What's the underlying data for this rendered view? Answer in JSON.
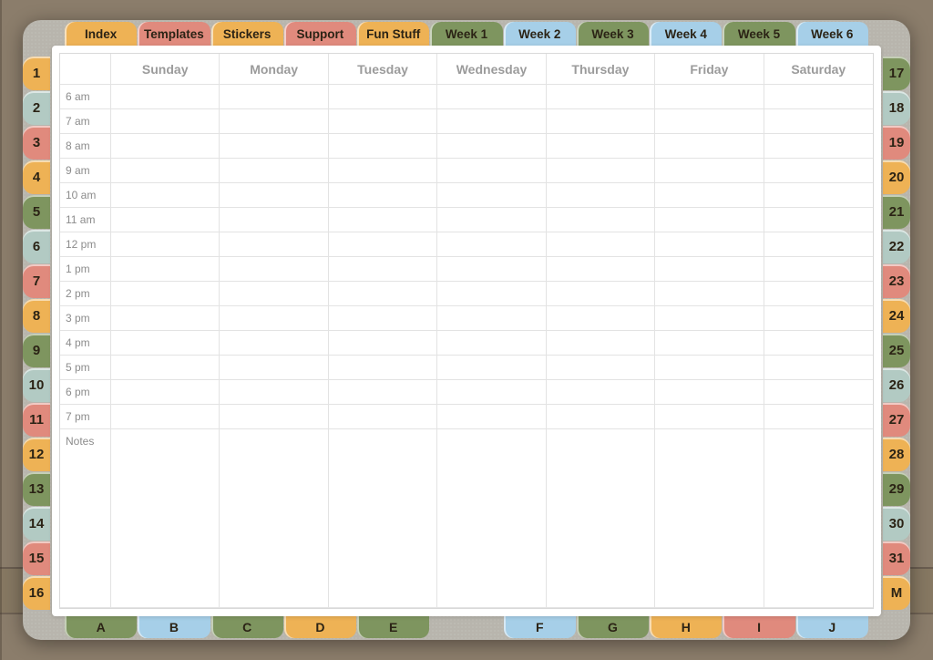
{
  "topTabs": [
    {
      "label": "Index",
      "color": "c-orange"
    },
    {
      "label": "Templates",
      "color": "c-red"
    },
    {
      "label": "Stickers",
      "color": "c-orange"
    },
    {
      "label": "Support",
      "color": "c-red"
    },
    {
      "label": "Fun Stuff",
      "color": "c-orange"
    },
    {
      "label": "Week 1",
      "color": "c-green"
    },
    {
      "label": "Week 2",
      "color": "c-blue"
    },
    {
      "label": "Week 3",
      "color": "c-green"
    },
    {
      "label": "Week 4",
      "color": "c-blue"
    },
    {
      "label": "Week 5",
      "color": "c-green"
    },
    {
      "label": "Week 6",
      "color": "c-blue"
    }
  ],
  "leftTabs": [
    {
      "label": "1",
      "color": "c-orange"
    },
    {
      "label": "2",
      "color": "c-teal"
    },
    {
      "label": "3",
      "color": "c-red"
    },
    {
      "label": "4",
      "color": "c-orange"
    },
    {
      "label": "5",
      "color": "c-green"
    },
    {
      "label": "6",
      "color": "c-teal"
    },
    {
      "label": "7",
      "color": "c-red"
    },
    {
      "label": "8",
      "color": "c-orange"
    },
    {
      "label": "9",
      "color": "c-green"
    },
    {
      "label": "10",
      "color": "c-teal"
    },
    {
      "label": "11",
      "color": "c-red"
    },
    {
      "label": "12",
      "color": "c-orange"
    },
    {
      "label": "13",
      "color": "c-green"
    },
    {
      "label": "14",
      "color": "c-teal"
    },
    {
      "label": "15",
      "color": "c-red"
    },
    {
      "label": "16",
      "color": "c-orange"
    }
  ],
  "rightTabs": [
    {
      "label": "17",
      "color": "c-green"
    },
    {
      "label": "18",
      "color": "c-teal"
    },
    {
      "label": "19",
      "color": "c-red"
    },
    {
      "label": "20",
      "color": "c-orange"
    },
    {
      "label": "21",
      "color": "c-green"
    },
    {
      "label": "22",
      "color": "c-teal"
    },
    {
      "label": "23",
      "color": "c-red"
    },
    {
      "label": "24",
      "color": "c-orange"
    },
    {
      "label": "25",
      "color": "c-green"
    },
    {
      "label": "26",
      "color": "c-teal"
    },
    {
      "label": "27",
      "color": "c-red"
    },
    {
      "label": "28",
      "color": "c-orange"
    },
    {
      "label": "29",
      "color": "c-green"
    },
    {
      "label": "30",
      "color": "c-teal"
    },
    {
      "label": "31",
      "color": "c-red"
    },
    {
      "label": "M",
      "color": "c-orange"
    }
  ],
  "bottomTabs": [
    {
      "label": "A",
      "color": "c-green"
    },
    {
      "label": "B",
      "color": "c-blue"
    },
    {
      "label": "C",
      "color": "c-green"
    },
    {
      "label": "D",
      "color": "c-orange"
    },
    {
      "label": "E",
      "color": "c-green"
    },
    {
      "label": "",
      "color": ""
    },
    {
      "label": "F",
      "color": "c-blue"
    },
    {
      "label": "G",
      "color": "c-green"
    },
    {
      "label": "H",
      "color": "c-orange"
    },
    {
      "label": "I",
      "color": "c-red"
    },
    {
      "label": "J",
      "color": "c-blue"
    }
  ],
  "days": [
    "Sunday",
    "Monday",
    "Tuesday",
    "Wednesday",
    "Thursday",
    "Friday",
    "Saturday"
  ],
  "hours": [
    "6 am",
    "7 am",
    "8 am",
    "9 am",
    "10 am",
    "11 am",
    "12 pm",
    "1 pm",
    "2 pm",
    "3 pm",
    "4 pm",
    "5 pm",
    "6 pm",
    "7 pm"
  ],
  "notesLabel": "Notes"
}
